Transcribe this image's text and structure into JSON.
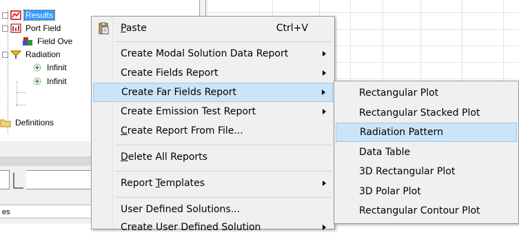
{
  "tree": {
    "items": [
      {
        "label": "Results",
        "expander": "+",
        "icon": "results-icon",
        "selected": true
      },
      {
        "label": "Port Field",
        "expander": "+",
        "icon": "port-field-icon",
        "selected": false
      },
      {
        "label": "Field Ove",
        "expander": "",
        "icon": "field-overlays-icon",
        "selected": false
      },
      {
        "label": "Radiation",
        "expander": "−",
        "icon": "radiation-icon",
        "selected": false
      },
      {
        "label": "Infinit",
        "expander": "",
        "icon": "infinite-sphere-icon",
        "selected": false
      },
      {
        "label": "Infinit",
        "expander": "",
        "icon": "infinite-sphere-icon",
        "selected": false
      },
      {
        "label": "Definitions",
        "expander": "",
        "icon": "folder-icon",
        "selected": false
      }
    ]
  },
  "lower_panel": {
    "header_text": "es"
  },
  "context_menu": {
    "items": [
      {
        "type": "item",
        "label": "Paste",
        "underline": "P",
        "shortcut": "Ctrl+V",
        "submenu": false,
        "icon": "paste-icon"
      },
      {
        "type": "separator"
      },
      {
        "type": "item",
        "label": "Create Modal Solution Data Report",
        "submenu": true
      },
      {
        "type": "item",
        "label": "Create Fields Report",
        "submenu": true
      },
      {
        "type": "item",
        "label": "Create Far Fields Report",
        "submenu": true,
        "highlighted": true
      },
      {
        "type": "item",
        "label": "Create Emission Test Report",
        "submenu": true
      },
      {
        "type": "item",
        "label": "Create Report From File...",
        "underline": "C",
        "submenu": false
      },
      {
        "type": "separator"
      },
      {
        "type": "item",
        "label": "Delete All Reports",
        "underline": "D",
        "submenu": false
      },
      {
        "type": "separator"
      },
      {
        "type": "item",
        "label": "Report Templates",
        "underline": "T",
        "submenu": true
      },
      {
        "type": "separator"
      },
      {
        "type": "item",
        "label": "User Defined Solutions...",
        "submenu": false
      },
      {
        "type": "item",
        "label": "Create User Defined Solution",
        "submenu": true
      }
    ]
  },
  "submenu": {
    "items": [
      {
        "label": "Rectangular Plot",
        "highlighted": false
      },
      {
        "label": "Rectangular Stacked Plot",
        "highlighted": false
      },
      {
        "label": "Radiation Pattern",
        "highlighted": true
      },
      {
        "label": "Data Table",
        "highlighted": false
      },
      {
        "label": "3D Rectangular Plot",
        "highlighted": false
      },
      {
        "label": "3D Polar Plot",
        "highlighted": false
      },
      {
        "label": "Rectangular Contour Plot",
        "highlighted": false
      }
    ]
  },
  "colors": {
    "selection": "#3399ff",
    "menu_highlight": "#cce4f7",
    "menu_highlight_border": "#99c9ef",
    "menu_bg": "#f0f0f0"
  }
}
